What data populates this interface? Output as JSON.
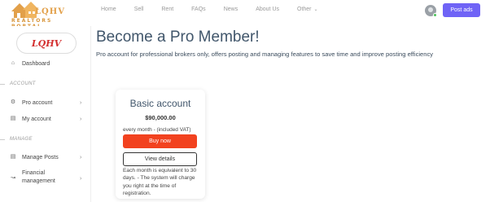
{
  "header": {
    "logo_text": "LQHV",
    "logo_subtitle": "REALTORS PORTAL",
    "nav": [
      {
        "label": "Home"
      },
      {
        "label": "Sell"
      },
      {
        "label": "Rent"
      },
      {
        "label": "FAQs"
      },
      {
        "label": "News"
      },
      {
        "label": "About Us"
      },
      {
        "label": "Other"
      }
    ],
    "post_ads_label": "Post ads",
    "colors": {
      "post_ads": "#6f63f6",
      "online_dot": "#4cc15a"
    }
  },
  "sidebar": {
    "logo_text": "LQHV",
    "items": [
      {
        "label": "Dashboard",
        "icon": "home-icon"
      },
      {
        "label": "Pro account",
        "icon": "gear-icon"
      },
      {
        "label": "My account",
        "icon": "id-card-icon"
      },
      {
        "label": "Manage Posts",
        "icon": "list-icon"
      },
      {
        "label": "Financial management",
        "line1": "Financial",
        "line2": "management",
        "icon": "chart-icon"
      }
    ],
    "sections": {
      "account": "ACCOUNT",
      "manage": "MANAGE"
    }
  },
  "main": {
    "title": "Become a Pro Member!",
    "subtitle": "Pro account for professional brokers only, offers posting and managing features to save time and improve posting efficiency"
  },
  "card": {
    "title": "Basic account",
    "price": "$90,000.00",
    "period_note": "every month - (included VAT)",
    "buy_label": "Buy now",
    "view_label": "View details",
    "description": "Each month is equivalent to 30 days. - The system will charge you right at the time of registration.",
    "colors": {
      "buy": "#f2421f"
    }
  }
}
